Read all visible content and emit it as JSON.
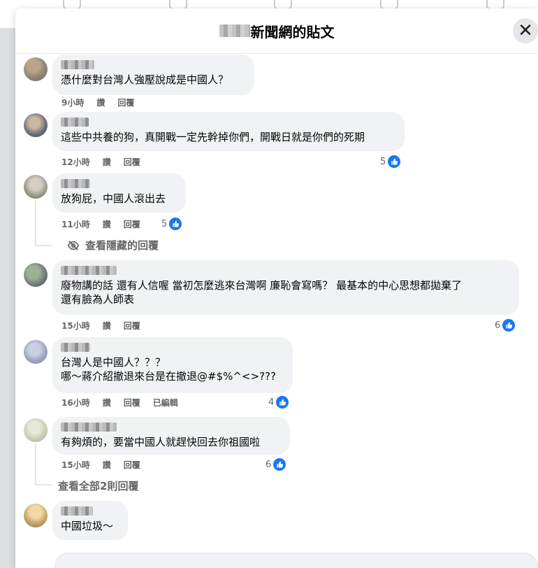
{
  "modal": {
    "title": "新聞網的貼文",
    "close_label": "✕"
  },
  "comments": [
    {
      "text": "憑什麼對台灣人強壓說成是中國人？",
      "time": "9小時",
      "like_label": "讚",
      "reply_label": "回覆",
      "likes": ""
    },
    {
      "text": "這些中共養的狗，真開戰一定先幹掉你們，開戰日就是你們的死期",
      "time": "12小時",
      "like_label": "讚",
      "reply_label": "回覆",
      "likes": "5"
    },
    {
      "text": "放狗屁，中國人滾出去",
      "time": "11小時",
      "like_label": "讚",
      "reply_label": "回覆",
      "likes": "5"
    },
    {
      "text": "廢物講的話 還有人信喔 當初怎麼逃來台灣啊 廉恥會寫嗎？ 最基本的中心思想都拋棄了\n還有臉為人師表",
      "time": "15小時",
      "like_label": "讚",
      "reply_label": "回覆",
      "likes": "6"
    },
    {
      "text": "台灣人是中國人？？？\n哪～蔣介紹撤退來台是在撤退@#$%^<>???",
      "time": "16小時",
      "like_label": "讚",
      "reply_label": "回覆",
      "edited_label": "已編輯",
      "likes": "4"
    },
    {
      "text": "有夠煩的，要當中國人就趕快回去你祖國啦",
      "time": "15小時",
      "like_label": "讚",
      "reply_label": "回覆",
      "likes": "6"
    },
    {
      "text": "中國垃圾～",
      "time": "",
      "like_label": "",
      "reply_label": "",
      "likes": ""
    }
  ],
  "hidden_replies_label": "查看隱藏的回覆",
  "view_all_replies_label": "查看全部2則回覆",
  "colors": {
    "accent": "#1877f2",
    "meta_text": "#65676b",
    "bubble": "#f0f2f5"
  },
  "icons": [
    "close-icon",
    "like-icon",
    "eye-slash-icon"
  ]
}
